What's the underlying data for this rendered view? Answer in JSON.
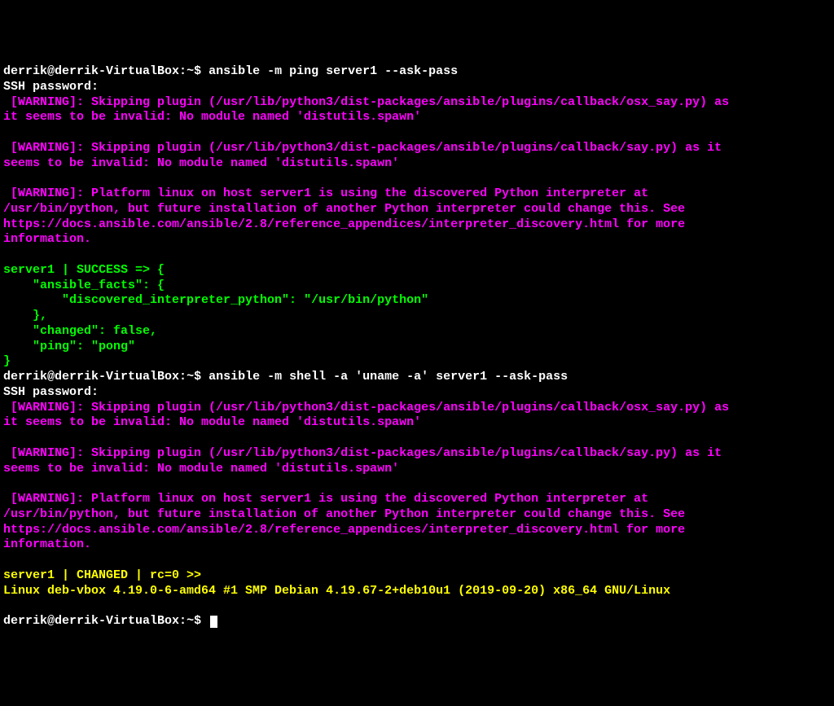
{
  "cmd1": {
    "prompt_user": "derrik@derrik-VirtualBox",
    "prompt_sep1": ":",
    "prompt_path": "~",
    "prompt_sep2": "$ ",
    "command": "ansible -m ping server1 --ask-pass",
    "ssh_line": "SSH password:",
    "warn1": " [WARNING]: Skipping plugin (/usr/lib/python3/dist-packages/ansible/plugins/callback/osx_say.py) as\nit seems to be invalid: No module named 'distutils.spawn'",
    "warn2": " [WARNING]: Skipping plugin (/usr/lib/python3/dist-packages/ansible/plugins/callback/say.py) as it\nseems to be invalid: No module named 'distutils.spawn'",
    "warn3": " [WARNING]: Platform linux on host server1 is using the discovered Python interpreter at\n/usr/bin/python, but future installation of another Python interpreter could change this. See\nhttps://docs.ansible.com/ansible/2.8/reference_appendices/interpreter_discovery.html for more\ninformation.",
    "success": "server1 | SUCCESS => {\n    \"ansible_facts\": {\n        \"discovered_interpreter_python\": \"/usr/bin/python\"\n    },\n    \"changed\": false,\n    \"ping\": \"pong\"\n}"
  },
  "cmd2": {
    "prompt_user": "derrik@derrik-VirtualBox",
    "prompt_sep1": ":",
    "prompt_path": "~",
    "prompt_sep2": "$ ",
    "command": "ansible -m shell -a 'uname -a' server1 --ask-pass",
    "ssh_line": "SSH password:",
    "warn1": " [WARNING]: Skipping plugin (/usr/lib/python3/dist-packages/ansible/plugins/callback/osx_say.py) as\nit seems to be invalid: No module named 'distutils.spawn'",
    "warn2": " [WARNING]: Skipping plugin (/usr/lib/python3/dist-packages/ansible/plugins/callback/say.py) as it\nseems to be invalid: No module named 'distutils.spawn'",
    "warn3": " [WARNING]: Platform linux on host server1 is using the discovered Python interpreter at\n/usr/bin/python, but future installation of another Python interpreter could change this. See\nhttps://docs.ansible.com/ansible/2.8/reference_appendices/interpreter_discovery.html for more\ninformation.",
    "changed_header": "server1 | CHANGED | rc=0 >>",
    "uname_out": "Linux deb-vbox 4.19.0-6-amd64 #1 SMP Debian 4.19.67-2+deb10u1 (2019-09-20) x86_64 GNU/Linux"
  },
  "final_prompt": {
    "prompt_user": "derrik@derrik-VirtualBox",
    "prompt_sep1": ":",
    "prompt_path": "~",
    "prompt_sep2": "$ "
  }
}
